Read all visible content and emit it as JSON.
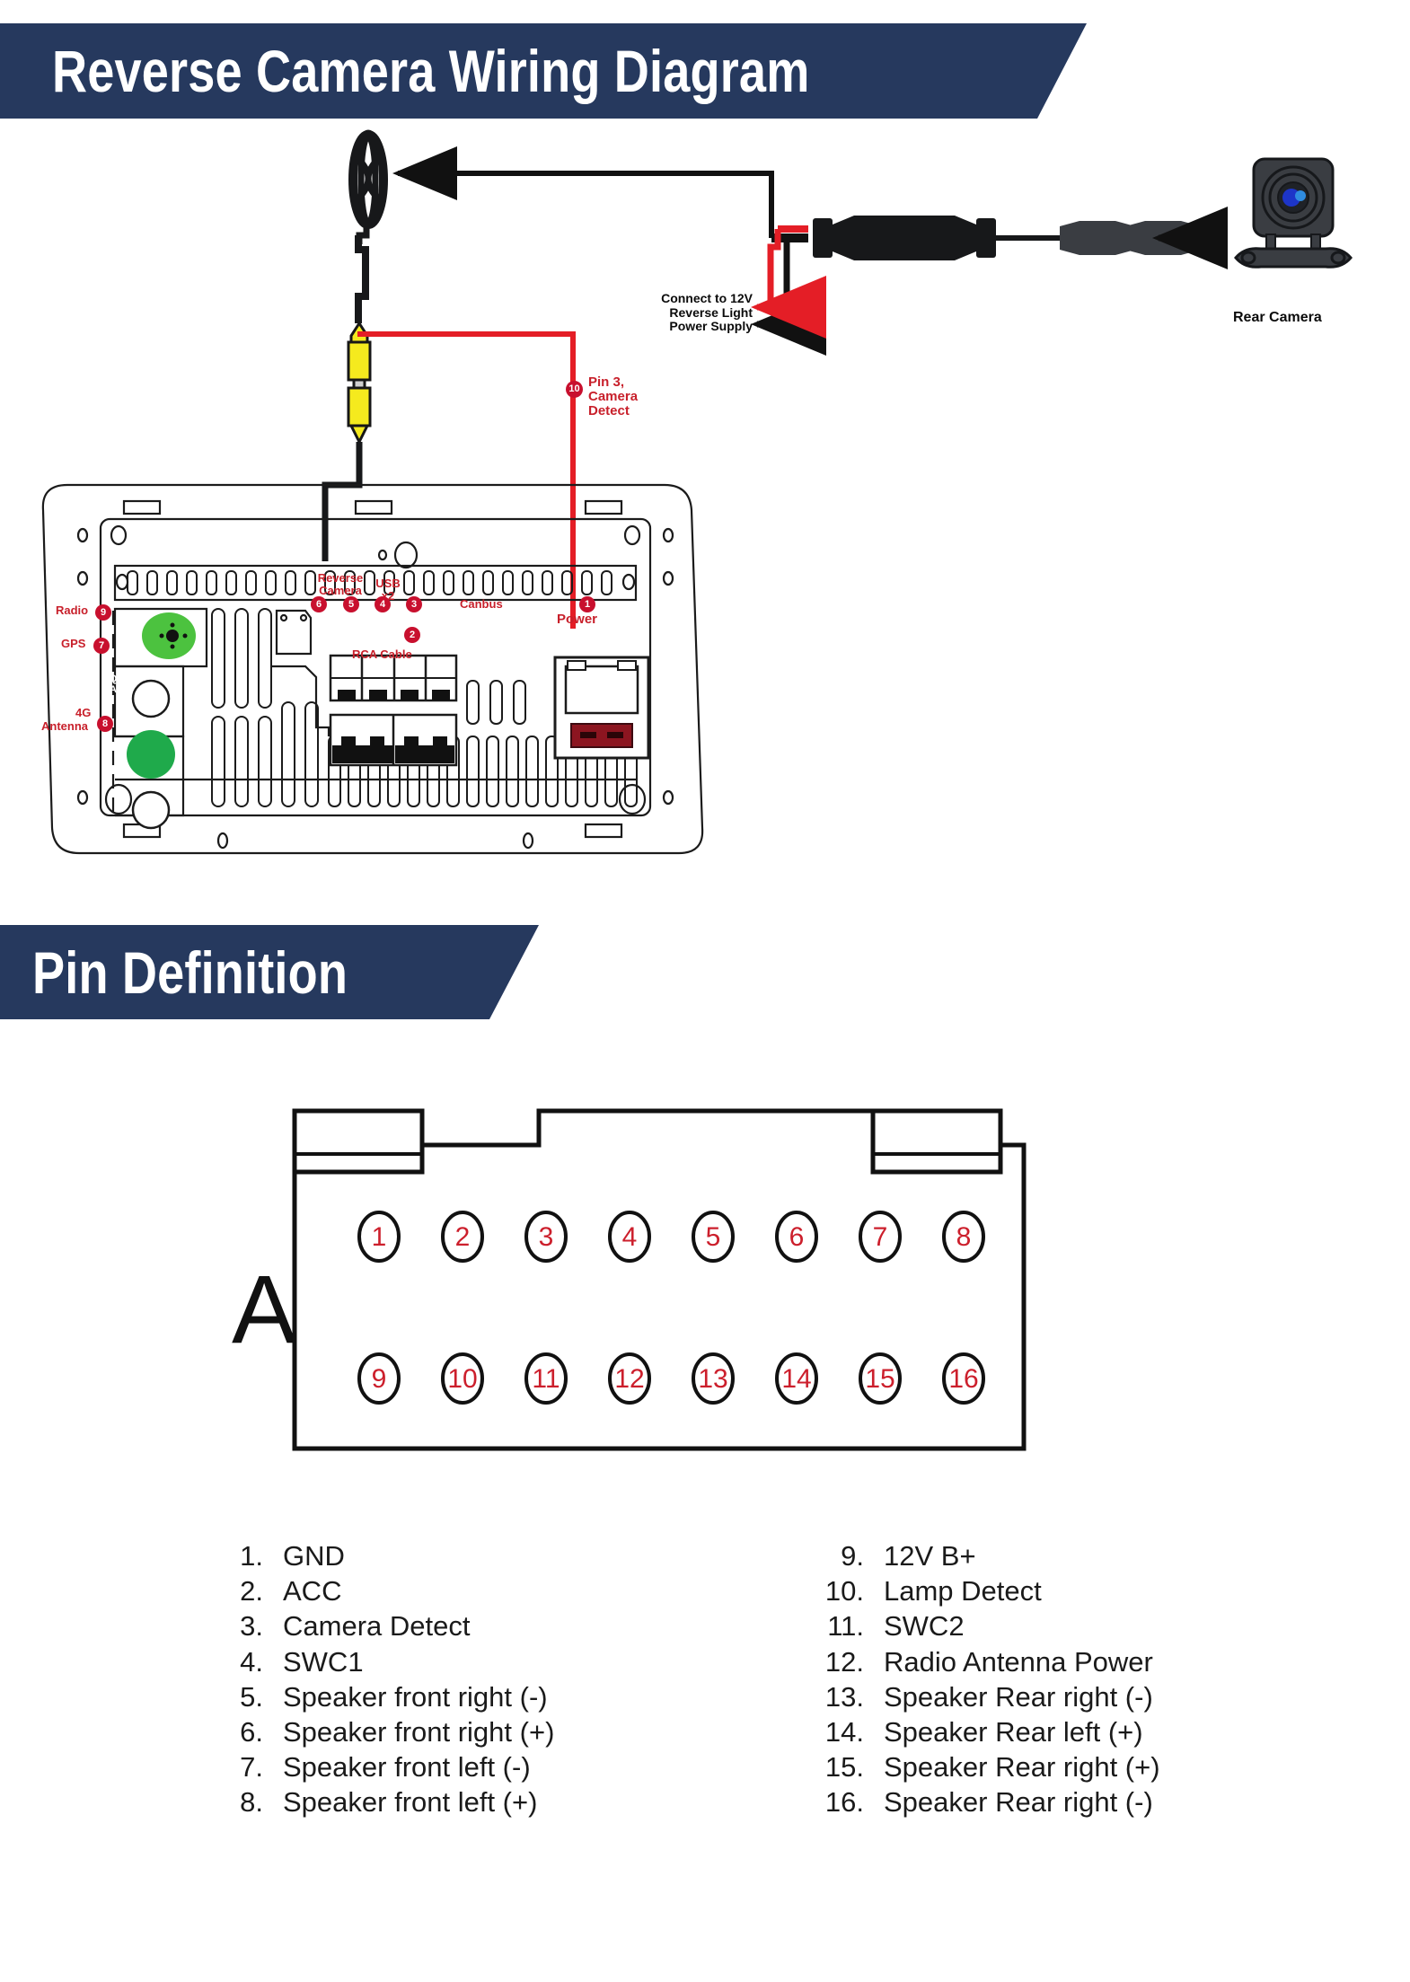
{
  "banners": {
    "wiring_title": "Reverse Camera Wiring Diagram",
    "pin_title": "Pin Definition"
  },
  "colors": {
    "banner_navy": "#26395e",
    "label_red": "#c8202b",
    "badge_red": "#c8102e",
    "wire_red": "#e41e26",
    "wire_black": "#111111",
    "rca_yellow": "#f5ea1e",
    "qc_green": "#1faa4b",
    "radio_green": "#4cc23f",
    "camera_body": "#3a3d42",
    "lens_blue": "#1d35c8"
  },
  "wiring": {
    "power_supply_note": [
      "Connect to 12V",
      "Reverse Light",
      "Power Supply"
    ],
    "camera_detect_note": [
      "Pin 3,",
      "Camera",
      "Detect"
    ],
    "camera_detect_badge": "10",
    "rear_camera_label": "Rear Camera"
  },
  "head_unit": {
    "ports": [
      {
        "badge": "6",
        "label": "Reverse Camera"
      },
      {
        "badge": "5",
        "label": "USB x2"
      },
      {
        "badge": "4",
        "label": "USB x2"
      },
      {
        "badge": "3",
        "label": "Canbus"
      },
      {
        "badge": "2",
        "label": "RCA Cable"
      },
      {
        "badge": "1",
        "label": "Power"
      }
    ],
    "labels": {
      "reverse_camera": "Reverse Camera",
      "reverse_camera_l1": "Reverse",
      "reverse_camera_l2": "Camera",
      "usb_l1": "USB",
      "usb_l2": "x2",
      "canbus": "Canbus",
      "rca_cable": "RCA Cable",
      "power": "Power",
      "radio": "Radio",
      "gps": "GPS",
      "antenna_l1": "4G",
      "antenna_l2": "Antenna",
      "qc_pass_l1": "QC",
      "qc_pass_l2": "PASS"
    },
    "badges": {
      "reverse_camera": "6",
      "usb_a": "5",
      "usb_b": "4",
      "canbus": "3",
      "rca": "2",
      "power": "1",
      "radio": "9",
      "gps": "7",
      "antenna": "8"
    }
  },
  "connector": {
    "name": "A",
    "pins_top": [
      "1",
      "2",
      "3",
      "4",
      "5",
      "6",
      "7",
      "8"
    ],
    "pins_bottom": [
      "9",
      "10",
      "11",
      "12",
      "13",
      "14",
      "15",
      "16"
    ]
  },
  "pin_definition": {
    "left": [
      {
        "n": "1.",
        "t": "GND"
      },
      {
        "n": "2.",
        "t": "ACC"
      },
      {
        "n": "3.",
        "t": "Camera Detect"
      },
      {
        "n": "4.",
        "t": "SWC1"
      },
      {
        "n": "5.",
        "t": "Speaker front right (-)"
      },
      {
        "n": "6.",
        "t": "Speaker front right (+)"
      },
      {
        "n": "7.",
        "t": "Speaker front left (-)"
      },
      {
        "n": "8.",
        "t": "Speaker front left (+)"
      }
    ],
    "right": [
      {
        "n": "9.",
        "t": "12V B+"
      },
      {
        "n": "10.",
        "t": "Lamp Detect"
      },
      {
        "n": "11.",
        "t": "SWC2"
      },
      {
        "n": "12.",
        "t": "Radio Antenna Power"
      },
      {
        "n": "13.",
        "t": "Speaker Rear right (-)"
      },
      {
        "n": "14.",
        "t": "Speaker Rear left (+)"
      },
      {
        "n": "15.",
        "t": "Speaker Rear right (+)"
      },
      {
        "n": "16.",
        "t": "Speaker Rear right (-)"
      }
    ]
  }
}
